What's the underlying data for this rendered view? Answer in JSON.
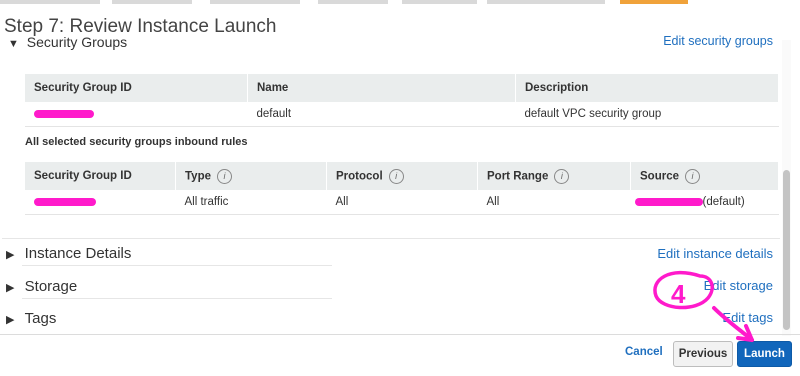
{
  "header": {
    "title": "Step 7: Review Instance Launch"
  },
  "security_groups": {
    "title": "Security Groups",
    "edit_link": "Edit security groups",
    "groups_table": {
      "columns": [
        "Security Group ID",
        "Name",
        "Description"
      ],
      "rows": [
        {
          "id": "",
          "name": "default",
          "description": "default VPC security group"
        }
      ]
    },
    "inbound_label": "All selected security groups inbound rules",
    "rules_table": {
      "columns": [
        "Security Group ID",
        "Type",
        "Protocol",
        "Port Range",
        "Source"
      ],
      "rows": [
        {
          "id": "",
          "type": "All traffic",
          "protocol": "All",
          "port_range": "All",
          "source": "(default)"
        }
      ]
    }
  },
  "sections": [
    {
      "title": "Instance Details",
      "edit_link": "Edit instance details"
    },
    {
      "title": "Storage",
      "edit_link": "Edit storage"
    },
    {
      "title": "Tags",
      "edit_link": "Edit tags"
    }
  ],
  "footer": {
    "cancel": "Cancel",
    "previous": "Previous",
    "launch": "Launch"
  },
  "annotation": {
    "number": "4",
    "color": "#ff1acb"
  },
  "colors": {
    "link": "#1f6fbf",
    "launch_button": "#1166bb",
    "active_step": "#f0a23a",
    "redaction": "#ff1acb"
  }
}
